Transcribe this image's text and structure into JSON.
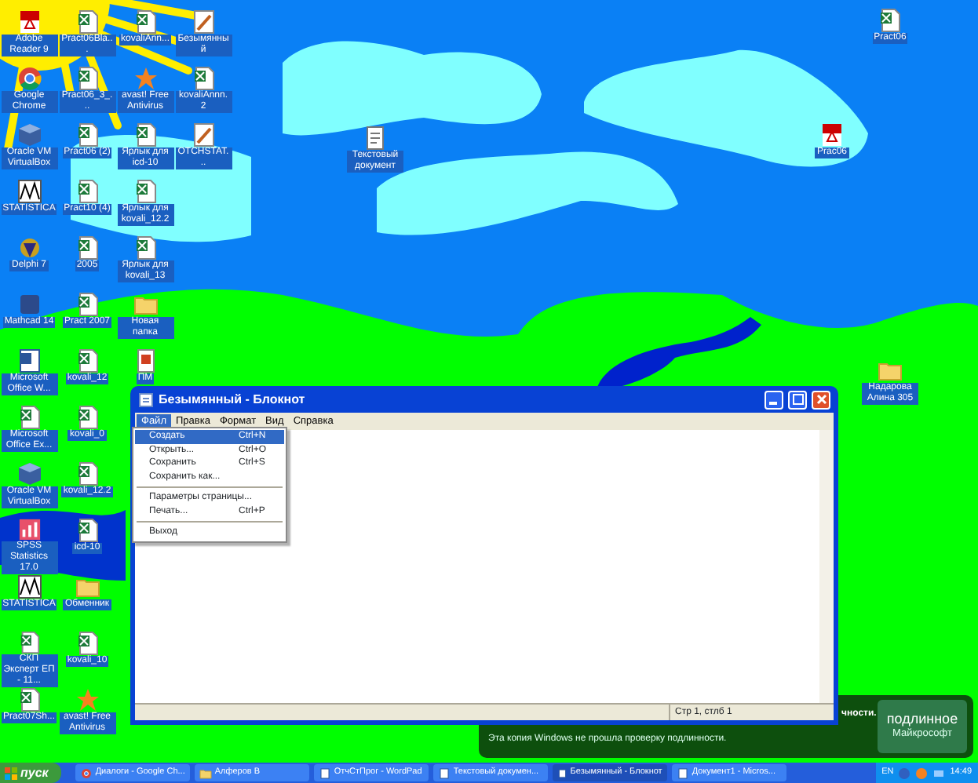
{
  "desktop": {
    "icon_columns": [
      [
        {
          "label": "Adobe Reader 9",
          "kind": "pdf"
        },
        {
          "label": "Google Chrome",
          "kind": "chrome"
        },
        {
          "label": "Oracle VM VirtualBox",
          "kind": "cube"
        },
        {
          "label": "STATISTICA",
          "kind": "chart"
        },
        {
          "label": "Delphi 7",
          "kind": "delphi"
        },
        {
          "label": "Mathcad 14",
          "kind": "app"
        },
        {
          "label": "Microsoft Office W...",
          "kind": "word"
        },
        {
          "label": "Microsoft Office Ex...",
          "kind": "sheet"
        },
        {
          "label": "Oracle VM VirtualBox",
          "kind": "cube"
        },
        {
          "label": "SPSS Statistics 17.0",
          "kind": "spss"
        },
        {
          "label": "STATISTICA",
          "kind": "chart"
        },
        {
          "label": "СКП Эксперт ЕП - 11...",
          "kind": "sheet"
        },
        {
          "label": "Pract07Sh...",
          "kind": "sheet"
        }
      ],
      [
        {
          "label": "Pract06Bla...",
          "kind": "sheet"
        },
        {
          "label": "Pract06_3_...",
          "kind": "sheet"
        },
        {
          "label": "Pract06 (2)",
          "kind": "sheet"
        },
        {
          "label": "Pract10 (4)",
          "kind": "sheet"
        },
        {
          "label": "2005",
          "kind": "sheet"
        },
        {
          "label": "Pract 2007",
          "kind": "sheet"
        },
        {
          "label": "kovali_12",
          "kind": "sheet"
        },
        {
          "label": "kovali_0",
          "kind": "sheet"
        },
        {
          "label": "kovali_12.2",
          "kind": "sheet"
        },
        {
          "label": "icd-10",
          "kind": "sheet"
        },
        {
          "label": "Обменник",
          "kind": "folder"
        },
        {
          "label": "kovali_10",
          "kind": "sheet"
        },
        {
          "label": "avast! Free Antivirus",
          "kind": "avast"
        }
      ],
      [
        {
          "label": "kovaliAnn...",
          "kind": "sheet"
        },
        {
          "label": "avast! Free Antivirus",
          "kind": "avast"
        },
        {
          "label": "Ярлык для icd-10",
          "kind": "sheet"
        },
        {
          "label": "Ярлык для kovali_12.2",
          "kind": "sheet"
        },
        {
          "label": "Ярлык для kovali_13",
          "kind": "sheet"
        },
        {
          "label": "Новая папка",
          "kind": "folder"
        },
        {
          "label": "ПМ",
          "kind": "file"
        }
      ],
      [
        {
          "label": "Безымянный",
          "kind": "paint"
        },
        {
          "label": "kovaliAnnn.2",
          "kind": "sheet"
        },
        {
          "label": "OTCHSTAT...",
          "kind": "paint"
        }
      ]
    ],
    "loose_icons": [
      {
        "label": "Текстовый документ",
        "kind": "text"
      },
      {
        "label": "Pract06",
        "kind": "sheet"
      },
      {
        "label": "Prac06",
        "kind": "pdf"
      },
      {
        "label": "Надарова Алина 305",
        "kind": "folder"
      }
    ]
  },
  "window": {
    "title": "Безымянный - Блокнот",
    "menu": [
      {
        "label": "Файл",
        "selected": true
      },
      {
        "label": "Правка",
        "selected": false
      },
      {
        "label": "Формат",
        "selected": false
      },
      {
        "label": "Вид",
        "selected": false
      },
      {
        "label": "Справка",
        "selected": false
      }
    ],
    "file_menu": [
      {
        "kind": "item",
        "label": "Создать",
        "shortcut": "Ctrl+N",
        "selected": true
      },
      {
        "kind": "item",
        "label": "Открыть...",
        "shortcut": "Ctrl+O",
        "selected": false
      },
      {
        "kind": "item",
        "label": "Сохранить",
        "shortcut": "Ctrl+S",
        "selected": false
      },
      {
        "kind": "item",
        "label": "Сохранить как...",
        "selected": false
      },
      {
        "kind": "separator"
      },
      {
        "kind": "item",
        "label": "Параметры страницы...",
        "selected": false
      },
      {
        "kind": "item",
        "label": "Печать...",
        "shortcut": "Ctrl+P",
        "selected": false
      },
      {
        "kind": "separator"
      },
      {
        "kind": "item",
        "label": "Выход",
        "selected": false
      }
    ],
    "status_bar": "Стр 1, стлб 1"
  },
  "notification": {
    "header": "чности.",
    "message": "Эта копия Windows не прошла проверку подлинности.",
    "badge": [
      "подлинное",
      "Майкрософт"
    ]
  },
  "taskbar": {
    "start": "пуск",
    "tasks": [
      {
        "label": "Диалоги - Google Ch...",
        "kind": "browser",
        "selected": false
      },
      {
        "label": "Алферов В",
        "kind": "folder",
        "selected": false
      },
      {
        "label": "ОтчСтПрог - WordPad",
        "kind": "doc",
        "selected": false
      },
      {
        "label": "Текстовый докумен...",
        "kind": "doc",
        "selected": false
      },
      {
        "label": "Безымянный - Блокнот",
        "kind": "doc",
        "selected": true
      },
      {
        "label": "Документ1 - Micros...",
        "kind": "doc",
        "selected": false
      }
    ],
    "language": "EN",
    "clock": "14:49"
  }
}
